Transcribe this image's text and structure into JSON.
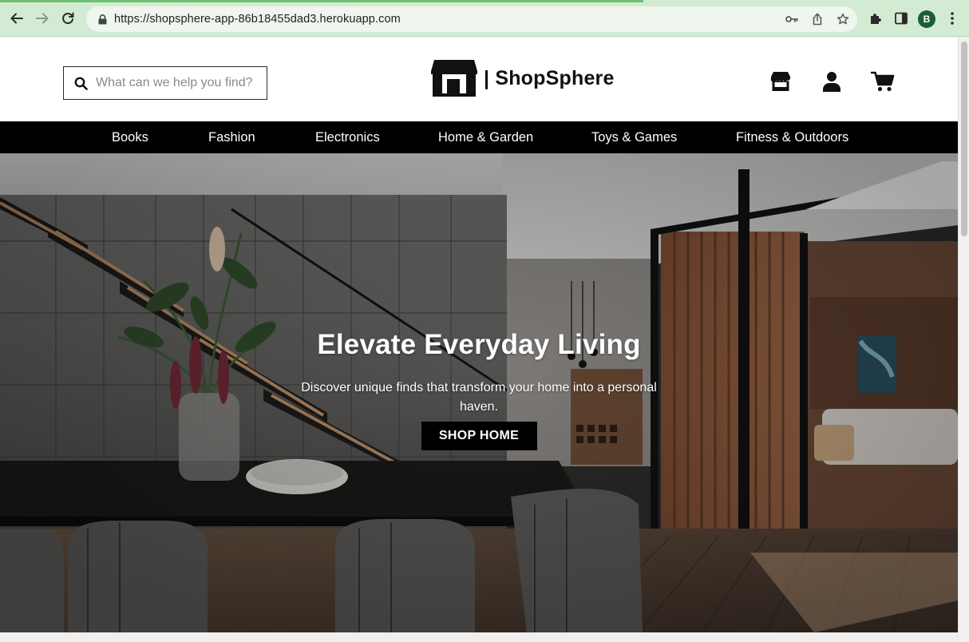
{
  "browser": {
    "url": "https://shopsphere-app-86b18455dad3.herokuapp.com",
    "profile_initial": "B",
    "icons": [
      "back-icon",
      "forward-icon",
      "reload-icon",
      "lock-icon",
      "key-icon",
      "share-icon",
      "star-icon",
      "extensions-icon",
      "sidepanel-icon",
      "menu-icon"
    ]
  },
  "header": {
    "search_placeholder": "What can we help you find?",
    "brand": "| ShopSphere",
    "icons": [
      "store-icon",
      "account-icon",
      "cart-icon"
    ]
  },
  "categories": [
    {
      "label": "Books"
    },
    {
      "label": "Fashion"
    },
    {
      "label": "Electronics"
    },
    {
      "label": "Home & Garden"
    },
    {
      "label": "Toys & Games"
    },
    {
      "label": "Fitness & Outdoors"
    }
  ],
  "hero": {
    "title": "Elevate Everyday Living",
    "subtitle": "Discover unique finds that transform your home into a personal haven.",
    "cta": "SHOP HOME"
  },
  "colors": {
    "chrome": "#d3ead3",
    "nav_bar": "#000000",
    "cta_bg": "#000000",
    "text_light": "#ffffff"
  }
}
